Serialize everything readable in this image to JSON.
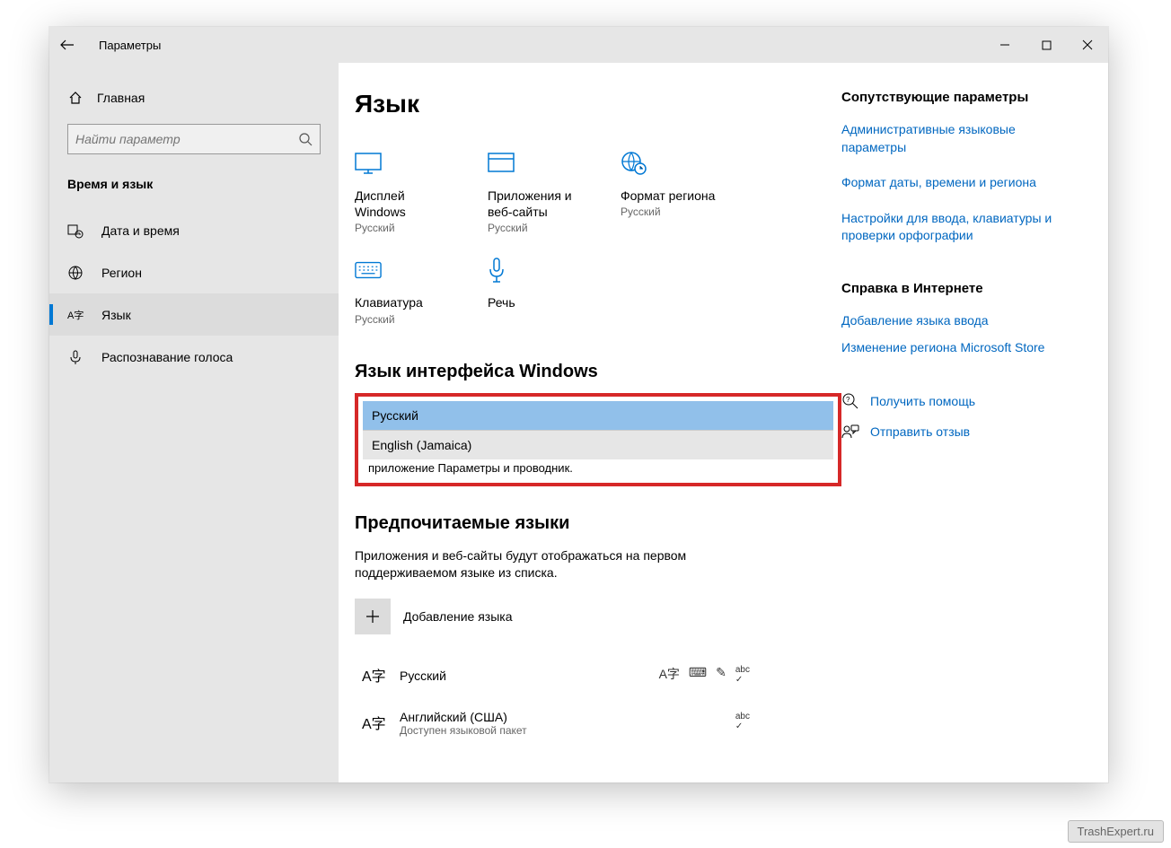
{
  "window": {
    "title": "Параметры"
  },
  "sidebar": {
    "home_label": "Главная",
    "search_placeholder": "Найти параметр",
    "category": "Время и язык",
    "items": [
      {
        "label": "Дата и время"
      },
      {
        "label": "Регион"
      },
      {
        "label": "Язык"
      },
      {
        "label": "Распознавание голоса"
      }
    ]
  },
  "main": {
    "title": "Язык",
    "tiles": [
      {
        "label": "Дисплей Windows",
        "sub": "Русский"
      },
      {
        "label": "Приложения и веб-сайты",
        "sub": "Русский"
      },
      {
        "label": "Формат региона",
        "sub": "Русский"
      },
      {
        "label": "Клавиатура",
        "sub": "Русский"
      },
      {
        "label": "Речь",
        "sub": ""
      }
    ],
    "section_display_lang": "Язык интерфейса Windows",
    "dropdown": {
      "options": [
        "Русский",
        "English (Jamaica)"
      ],
      "selected_index": 0
    },
    "partial_desc": "приложение  Параметры  и проводник.",
    "section_preferred": "Предпочитаемые языки",
    "preferred_desc": "Приложения и веб-сайты будут отображаться на первом поддерживаемом языке из списка.",
    "add_language": "Добавление языка",
    "languages": [
      {
        "name": "Русский",
        "sub": "",
        "badges": [
          "A字",
          "⌨",
          "✎",
          "abc"
        ]
      },
      {
        "name": "Английский (США)",
        "sub": "Доступен языковой пакет",
        "badges": [
          "abc"
        ]
      }
    ]
  },
  "rightcol": {
    "related_title": "Сопутствующие параметры",
    "related_links": [
      "Административные языковые параметры",
      "Формат даты, времени и региона",
      "Настройки для ввода, клавиатуры и проверки орфографии"
    ],
    "help_title": "Справка в Интернете",
    "help_links": [
      "Добавление языка ввода",
      "Изменение региона Microsoft Store"
    ],
    "get_help": "Получить помощь",
    "feedback": "Отправить отзыв"
  },
  "watermark": "TrashExpert.ru"
}
